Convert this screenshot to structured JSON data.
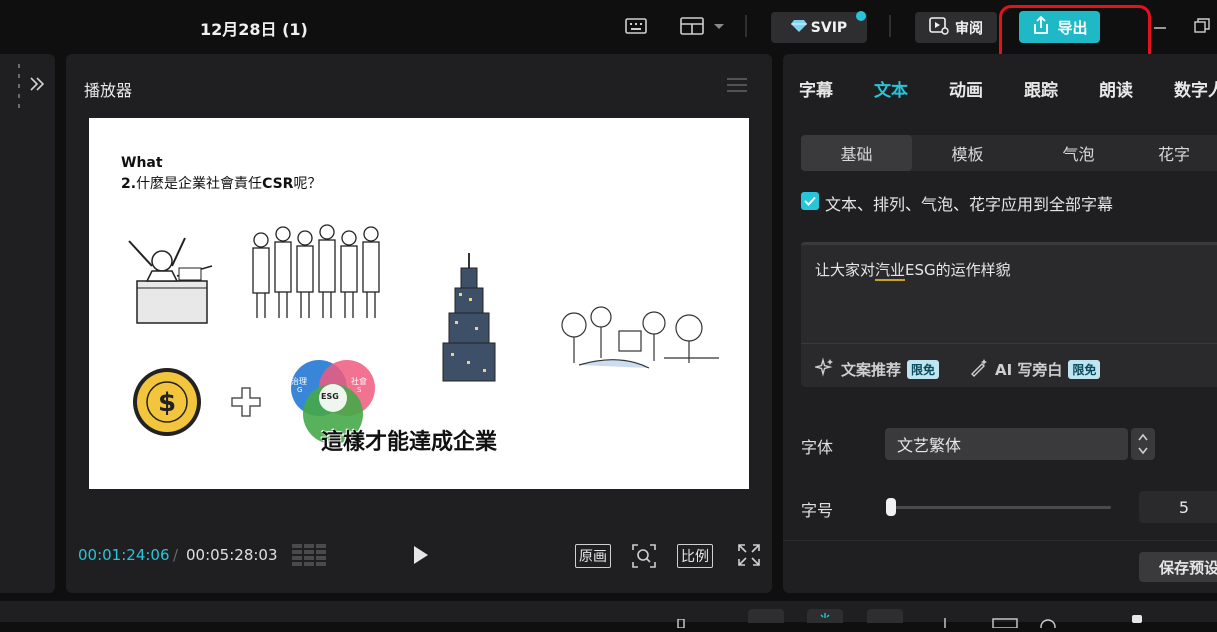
{
  "window": {
    "title": "12月28日 (1)"
  },
  "topbar": {
    "svip_label": "SVIP",
    "review_label": "审阅",
    "export_label": "导出"
  },
  "player": {
    "title": "播放器",
    "current_time": "00:01:24:06",
    "separator": "/",
    "total_time": "00:05:28:03",
    "original_label": "原画",
    "ratio_label": "比例",
    "slide": {
      "heading_en": "What",
      "heading_num": "2.",
      "heading_cn": "什麼是企業社會責任",
      "heading_csr": "CSR",
      "heading_end": "呢？",
      "venn_top_left": "治理",
      "venn_top_left_sub": "G",
      "venn_top_right": "社會",
      "venn_top_right_sub": "S",
      "venn_center": "ESG",
      "subtitle": "這樣才能達成企業"
    }
  },
  "right": {
    "tabs": [
      "字幕",
      "文本",
      "动画",
      "跟踪",
      "朗读",
      "数字人"
    ],
    "active_tab": "文本",
    "subtabs": [
      "基础",
      "模板",
      "气泡",
      "花字"
    ],
    "apply_all_label": "文本、排列、气泡、花字应用到全部字幕",
    "text_before": "让大家对",
    "text_underlined": "汽业",
    "text_after": "ESG的运作样貌",
    "tool_recommend": "文案推荐",
    "tool_ai": "AI 写旁白",
    "badge_free": "限免",
    "font_label": "字体",
    "font_value": "文艺繁体",
    "size_label": "字号",
    "size_value": "5",
    "save_preset": "保存预设"
  },
  "colors": {
    "accent": "#28c4d9",
    "export_bg": "#1fb8c7",
    "highlight_box": "#e3121b"
  }
}
